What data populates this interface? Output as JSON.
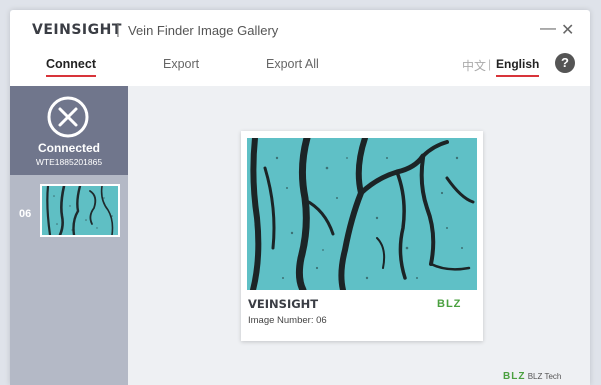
{
  "window": {
    "brand": "VEINSIGHT",
    "separator": "|",
    "title": "Vein Finder Image Gallery",
    "minimize": "—",
    "close": "✕"
  },
  "nav": {
    "tabs": [
      {
        "label": "Connect",
        "active": true
      },
      {
        "label": "Export",
        "active": false
      },
      {
        "label": "Export All",
        "active": false
      }
    ],
    "lang_cn": "中文",
    "lang_sep": "|",
    "lang_en": "English",
    "help": "?"
  },
  "sidebar": {
    "device": {
      "icon": "close-circle-icon",
      "status": "Connected",
      "id": "WTE1885201865"
    },
    "thumbnails": [
      {
        "number": "06"
      }
    ]
  },
  "card": {
    "brand": "VEINSIGHT",
    "logo": "BLZ",
    "caption": "Image Number: 06"
  },
  "footer": {
    "logo": "BLZ",
    "text": "BLZ Tech"
  },
  "colors": {
    "accent": "#d8343a",
    "sidebar": "#b4b9c6",
    "device_bg": "#70768c",
    "vein_bg": "#5fc0c6"
  }
}
